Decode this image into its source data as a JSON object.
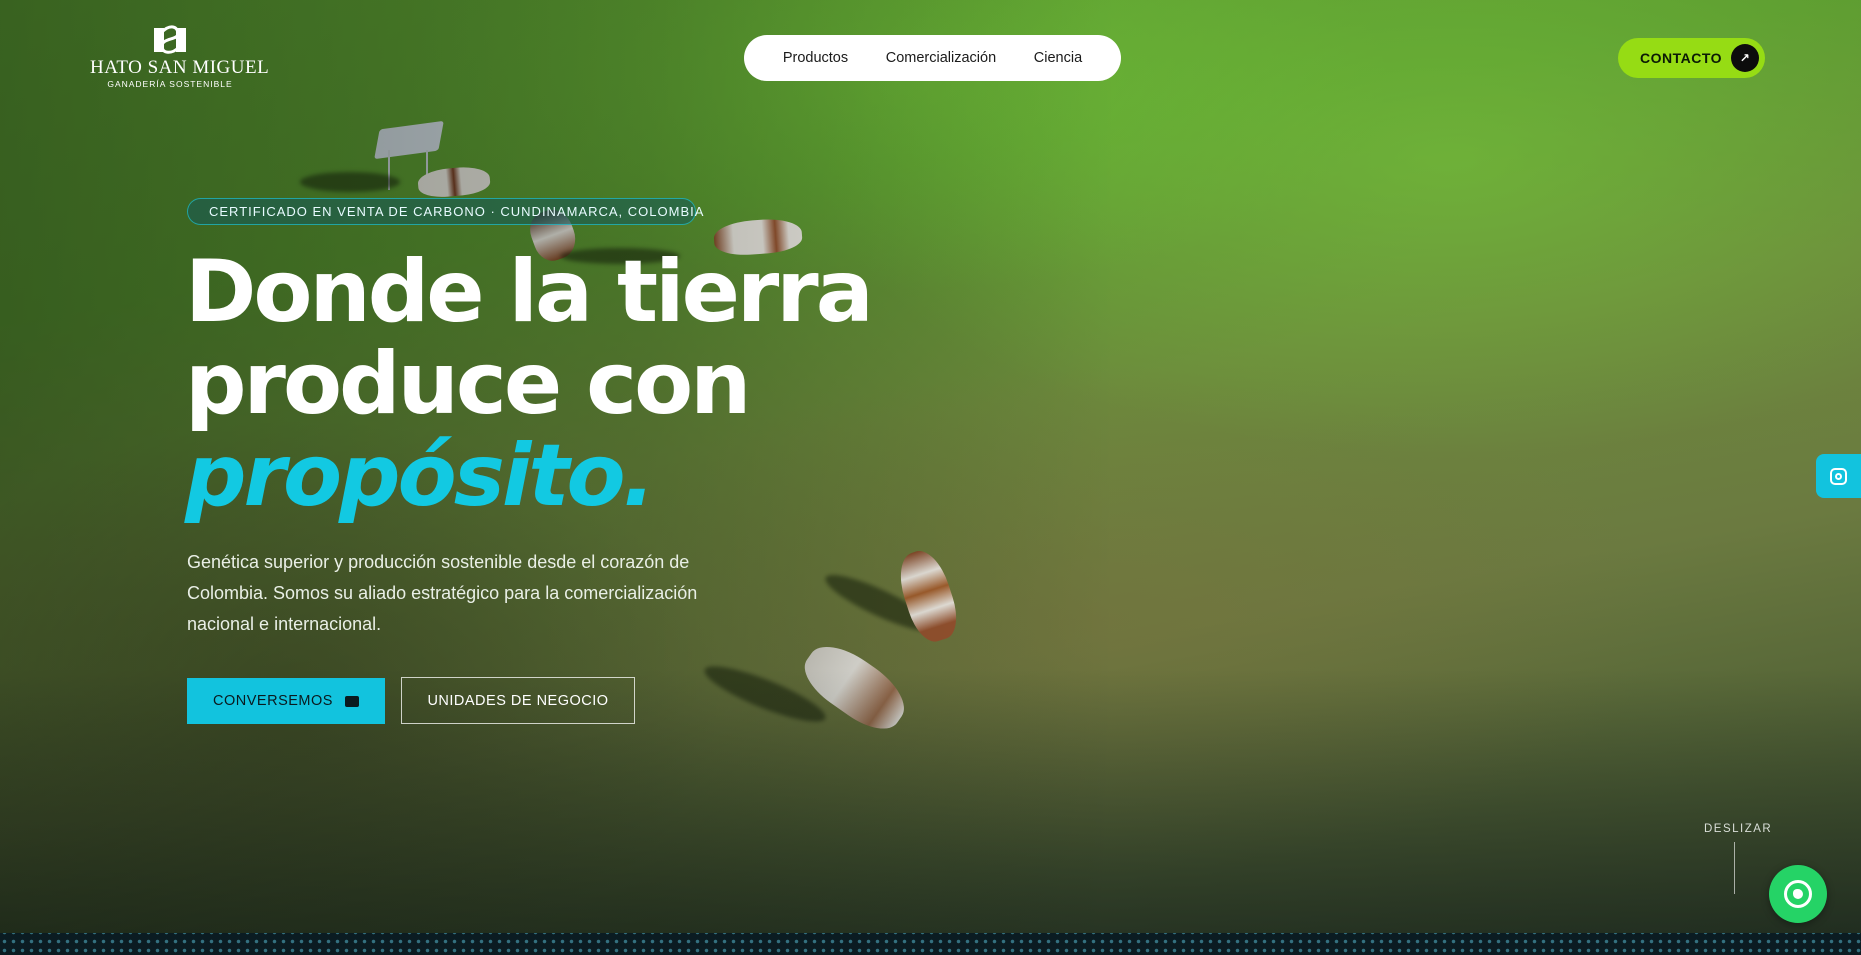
{
  "brand": {
    "monogram": "HSM",
    "name": "HATO SAN MIGUEL",
    "tagline": "GANADERÍA SOSTENIBLE"
  },
  "nav": {
    "items": [
      {
        "label": "Productos"
      },
      {
        "label": "Comercialización"
      },
      {
        "label": "Ciencia"
      }
    ]
  },
  "contact": {
    "label": "CONTACTO",
    "icon": "arrow-up-right-icon",
    "color": "#96dc14"
  },
  "hero": {
    "badge": "CERTIFICADO EN VENTA DE CARBONO · CUNDINAMARCA, COLOMBIA",
    "headline_line1": "Donde la tierra",
    "headline_line2": "produce con",
    "headline_accent": "propósito",
    "headline_period": ".",
    "lead": "Genética superior y producción sostenible desde el corazón de Colombia. Somos su aliado estratégico para la comercialización nacional e internacional.",
    "accent_color": "#12c9e2"
  },
  "cta": {
    "primary_label": "CONVERSEMOS",
    "primary_icon": "chat-icon",
    "secondary_label": "UNIDADES DE NEGOCIO"
  },
  "social": {
    "instagram_icon": "instagram-icon",
    "whatsapp_icon": "whatsapp-icon"
  },
  "scroll": {
    "label": "DESLIZAR"
  }
}
